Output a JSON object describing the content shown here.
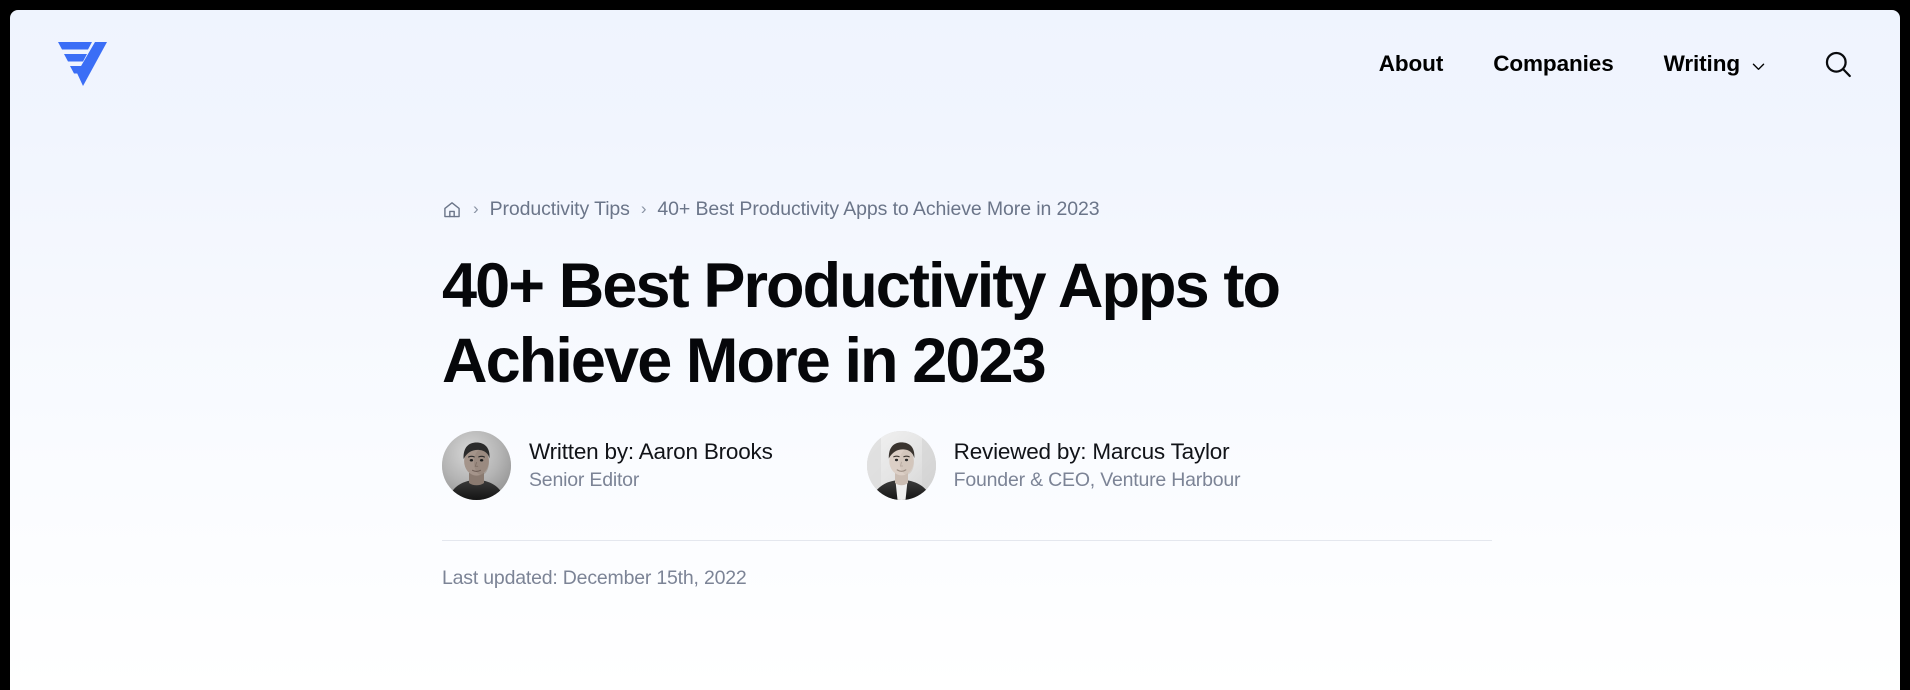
{
  "theme": {
    "brand_color": "#3B6EF6",
    "background_top": "#EFF4FE",
    "background_bottom": "#FFFFFF",
    "title_color": "#06070A",
    "muted_text_color": "#7C8496",
    "breadcrumb_color": "#6B7589",
    "divider_color": "#E4E7EE",
    "frame_color": "#000000"
  },
  "header": {
    "logo_name": "venture-harbour-logo",
    "nav": [
      {
        "label": "About",
        "has_dropdown": false
      },
      {
        "label": "Companies",
        "has_dropdown": false
      },
      {
        "label": "Writing",
        "has_dropdown": true
      }
    ],
    "search_icon": "search-icon"
  },
  "breadcrumb": {
    "home_icon": "home-icon",
    "separator": "›",
    "items": [
      {
        "label": "Productivity Tips",
        "current": false
      },
      {
        "label": "40+ Best Productivity Apps to Achieve More in 2023",
        "current": true
      }
    ]
  },
  "article": {
    "title": "40+ Best Productivity Apps to Achieve More in 2023",
    "bylines": [
      {
        "name": "Written by: Aaron Brooks",
        "role": "Senior Editor",
        "avatar_name": "author-avatar-aaron-brooks"
      },
      {
        "name": "Reviewed by: Marcus Taylor",
        "role": "Founder & CEO, Venture Harbour",
        "avatar_name": "reviewer-avatar-marcus-taylor"
      }
    ],
    "last_updated": "Last updated: December 15th, 2022"
  }
}
